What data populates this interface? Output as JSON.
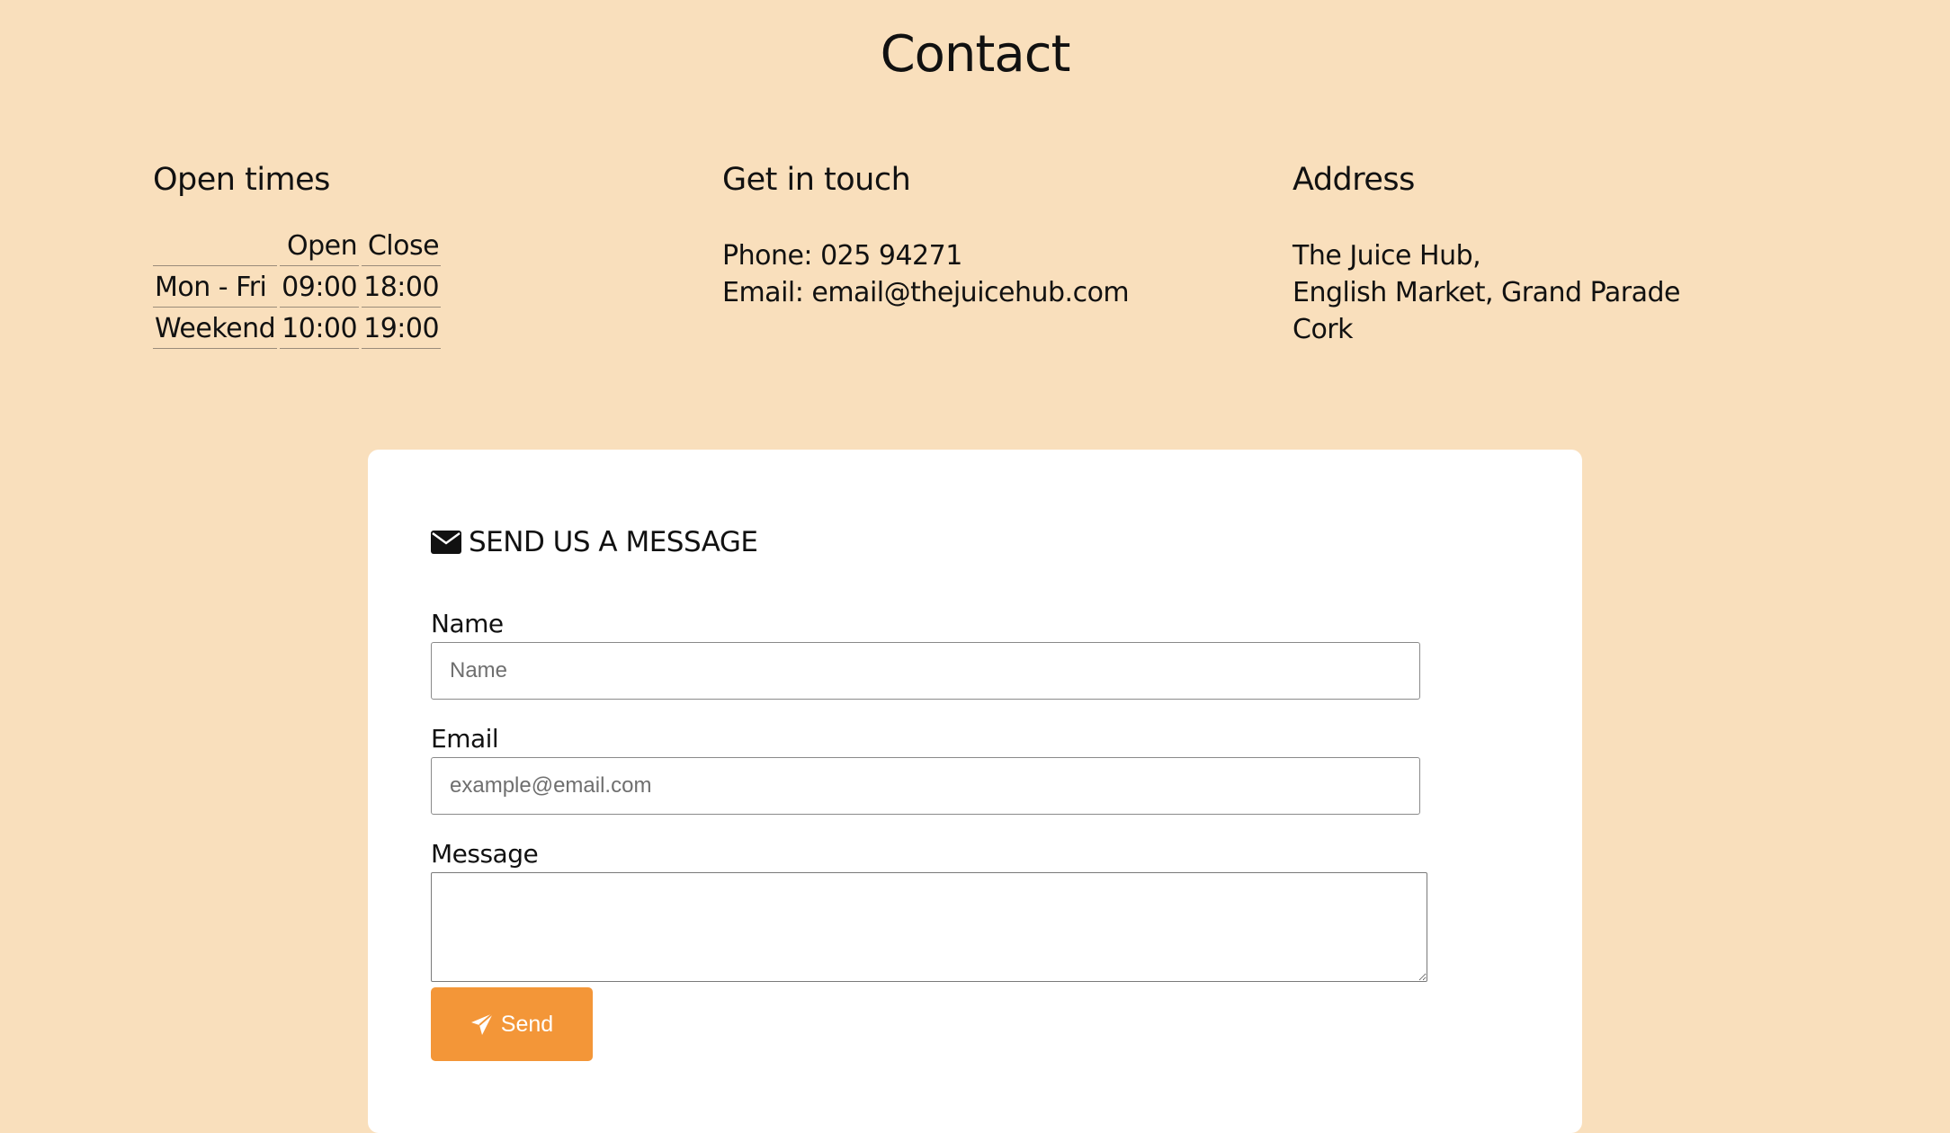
{
  "page": {
    "title": "Contact"
  },
  "hours": {
    "heading": "Open times",
    "columns": [
      "",
      "Open",
      "Close"
    ],
    "rows": [
      {
        "day": "Mon - Fri",
        "open": "09:00",
        "close": "18:00"
      },
      {
        "day": "Weekend",
        "open": "10:00",
        "close": "19:00"
      }
    ]
  },
  "touch": {
    "heading": "Get in touch",
    "phone": "Phone: 025 94271",
    "email": "Email: email@thejuicehub.com"
  },
  "address": {
    "heading": "Address",
    "line1": "The Juice Hub,",
    "line2": "English Market, Grand Parade",
    "line3": "Cork"
  },
  "form": {
    "heading": "SEND US A MESSAGE",
    "heading_icon": "envelope-icon",
    "name_label": "Name",
    "name_placeholder": "Name",
    "email_label": "Email",
    "email_placeholder": "example@email.com",
    "message_label": "Message",
    "send_label": "Send",
    "send_icon": "paper-plane-icon"
  },
  "colors": {
    "background": "#f9dfbc",
    "card": "#ffffff",
    "accent": "#f39638"
  }
}
